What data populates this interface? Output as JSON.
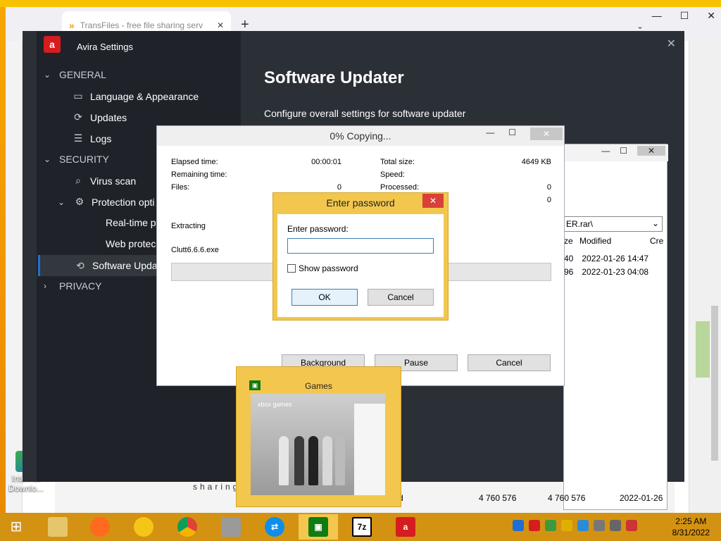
{
  "browser": {
    "tab_title": "TransFiles - free file sharing serv",
    "tab_close": "✕",
    "new_tab": "+",
    "dropdown": "⌄",
    "minimize": "—",
    "maximize": "☐",
    "close": "✕",
    "bottom_text": "sharing"
  },
  "desktop": {
    "icon_label": "Internet Downlo..."
  },
  "avira": {
    "window_title": "Avira Settings",
    "close": "✕",
    "nav": {
      "general": "GENERAL",
      "language": "Language & Appearance",
      "updates": "Updates",
      "logs": "Logs",
      "security": "SECURITY",
      "virus_scan": "Virus scan",
      "protection_options": "Protection opti",
      "real_time": "Real-time p",
      "web_protection": "Web protec",
      "software_updater": "Software Upda",
      "privacy": "PRIVACY"
    },
    "main_title": "Software Updater",
    "main_subtitle": "Configure overall settings for software updater"
  },
  "filemanager": {
    "min": "—",
    "max": "☐",
    "close": "✕",
    "path": "ER.rar\\",
    "columns": [
      "ze",
      "Modified",
      "Cre"
    ],
    "rows": [
      {
        "size": "40",
        "modified": "2022-01-26 14:47"
      },
      {
        "size": "96",
        "modified": "2022-01-23 04:08"
      }
    ],
    "status_d": "d",
    "status_size1": "4 760 576",
    "status_size2": "4 760 576",
    "status_date": "2022-01-26"
  },
  "copy_dialog": {
    "title": "0% Copying...",
    "min": "—",
    "max": "☐",
    "close": "✕",
    "elapsed_label": "Elapsed time:",
    "elapsed_value": "00:00:01",
    "remaining_label": "Remaining time:",
    "files_label": "Files:",
    "files_value": "0",
    "total_size_label": "Total size:",
    "total_size_value": "4649 KB",
    "speed_label": "Speed:",
    "processed_label": "Processed:",
    "processed_value": "0",
    "extra_value": "0",
    "operation": "Extracting",
    "current_file": "Clutt6.6.6.exe",
    "progress_fraction": 0,
    "background_button": "Background",
    "pause_button": "Pause",
    "cancel_button": "Cancel"
  },
  "password_dialog": {
    "title": "Enter password",
    "close": "✕",
    "label": "Enter password:",
    "value": "",
    "show_password_label": "Show password",
    "show_password_checked": false,
    "ok_button": "OK",
    "cancel_button": "Cancel"
  },
  "thumbnail": {
    "title": "Games",
    "header": "xbox games"
  },
  "taskbar": {
    "items": [
      "file-explorer",
      "firefox",
      "chrome-canary",
      "chrome",
      "keys",
      "teamviewer",
      "games",
      "7zip",
      "avira"
    ],
    "sevenzip_label": "7z",
    "time": "2:25 AM",
    "date": "8/31/2022"
  }
}
